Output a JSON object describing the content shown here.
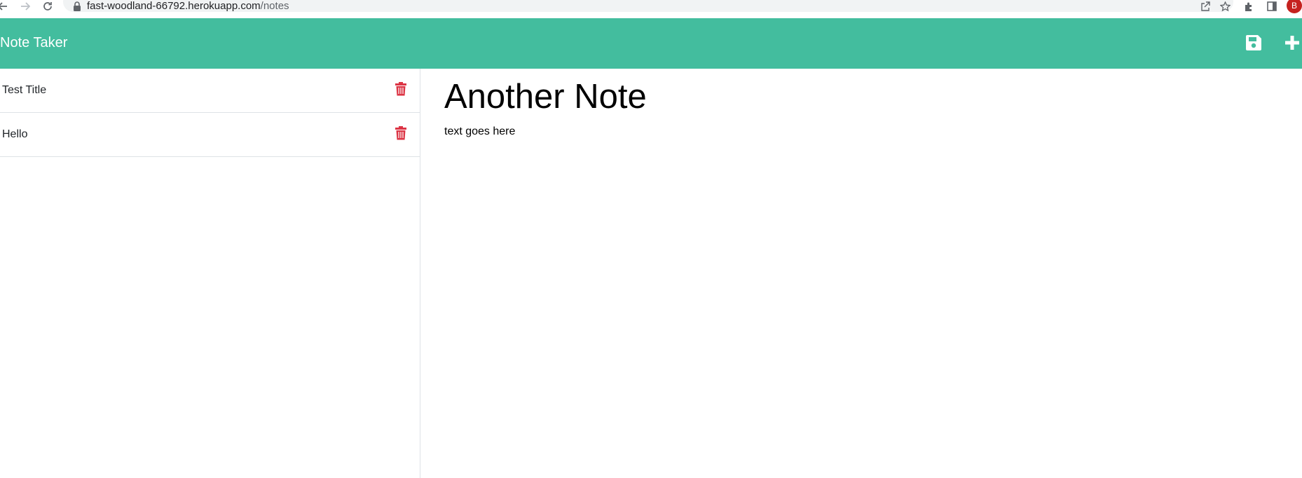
{
  "browser": {
    "url_host": "fast-woodland-66792.herokuapp.com",
    "url_path": "/notes",
    "profile_initial": "B",
    "icons": [
      "back-arrow-icon",
      "forward-arrow-icon",
      "reload-icon",
      "lock-icon",
      "share-icon",
      "star-icon",
      "extensions-icon",
      "side-panel-icon"
    ]
  },
  "header": {
    "brand": "Note Taker",
    "bg_color": "#43bd9e",
    "save_icon": "save-icon",
    "new_icon": "plus-icon"
  },
  "sidebar": {
    "items": [
      {
        "label": "Test Title",
        "delete_icon": "trash-icon"
      },
      {
        "label": "Hello",
        "delete_icon": "trash-icon"
      }
    ],
    "delete_color": "#dc3545"
  },
  "editor": {
    "title": "Another Note",
    "body": "text goes here"
  }
}
